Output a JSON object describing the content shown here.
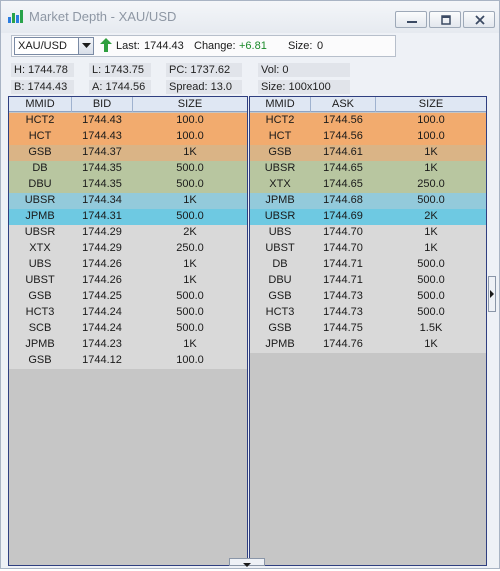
{
  "window": {
    "title": "Market Depth - XAU/USD"
  },
  "toolbar": {
    "symbol": "XAU/USD",
    "last_label": "Last:",
    "last_value": "1744.43",
    "change_label": "Change:",
    "change_value": "+6.81",
    "size_label": "Size:",
    "size_value": "0"
  },
  "stats": {
    "high": "H: 1744.78",
    "low": "L: 1743.75",
    "pc": "PC: 1737.62",
    "vol": "Vol: 0",
    "bid": "B: 1744.43",
    "ask": "A: 1744.56",
    "spread": "Spread: 13.0",
    "size": "Size: 100x100"
  },
  "bid_panel": {
    "columns": [
      "MMID",
      "BID",
      "SIZE"
    ],
    "rows": [
      {
        "mmid": "HCT2",
        "price": "1744.43",
        "size": "100.0",
        "color": "#f2ab6e"
      },
      {
        "mmid": "HCT",
        "price": "1744.43",
        "size": "100.0",
        "color": "#f2ab6e"
      },
      {
        "mmid": "GSB",
        "price": "1744.37",
        "size": "1K",
        "color": "#dab486"
      },
      {
        "mmid": "DB",
        "price": "1744.35",
        "size": "500.0",
        "color": "#b8c6a0"
      },
      {
        "mmid": "DBU",
        "price": "1744.35",
        "size": "500.0",
        "color": "#b8c6a0"
      },
      {
        "mmid": "UBSR",
        "price": "1744.34",
        "size": "1K",
        "color": "#93cadb"
      },
      {
        "mmid": "JPMB",
        "price": "1744.31",
        "size": "500.0",
        "color": "#6ec9e2"
      },
      {
        "mmid": "UBSR",
        "price": "1744.29",
        "size": "2K",
        "color": "#d9d9d9"
      },
      {
        "mmid": "XTX",
        "price": "1744.29",
        "size": "250.0",
        "color": "#d9d9d9"
      },
      {
        "mmid": "UBS",
        "price": "1744.26",
        "size": "1K",
        "color": "#d9d9d9"
      },
      {
        "mmid": "UBST",
        "price": "1744.26",
        "size": "1K",
        "color": "#d9d9d9"
      },
      {
        "mmid": "GSB",
        "price": "1744.25",
        "size": "500.0",
        "color": "#d9d9d9"
      },
      {
        "mmid": "HCT3",
        "price": "1744.24",
        "size": "500.0",
        "color": "#d9d9d9"
      },
      {
        "mmid": "SCB",
        "price": "1744.24",
        "size": "500.0",
        "color": "#d9d9d9"
      },
      {
        "mmid": "JPMB",
        "price": "1744.23",
        "size": "1K",
        "color": "#d9d9d9"
      },
      {
        "mmid": "GSB",
        "price": "1744.12",
        "size": "100.0",
        "color": "#d9d9d9"
      }
    ]
  },
  "ask_panel": {
    "columns": [
      "MMID",
      "ASK",
      "SIZE"
    ],
    "rows": [
      {
        "mmid": "HCT2",
        "price": "1744.56",
        "size": "100.0",
        "color": "#f2ab6e"
      },
      {
        "mmid": "HCT",
        "price": "1744.56",
        "size": "100.0",
        "color": "#f2ab6e"
      },
      {
        "mmid": "GSB",
        "price": "1744.61",
        "size": "1K",
        "color": "#dab486"
      },
      {
        "mmid": "UBSR",
        "price": "1744.65",
        "size": "1K",
        "color": "#b8c6a0"
      },
      {
        "mmid": "XTX",
        "price": "1744.65",
        "size": "250.0",
        "color": "#b8c6a0"
      },
      {
        "mmid": "JPMB",
        "price": "1744.68",
        "size": "500.0",
        "color": "#93cadb"
      },
      {
        "mmid": "UBSR",
        "price": "1744.69",
        "size": "2K",
        "color": "#6ec9e2"
      },
      {
        "mmid": "UBS",
        "price": "1744.70",
        "size": "1K",
        "color": "#d9d9d9"
      },
      {
        "mmid": "UBST",
        "price": "1744.70",
        "size": "1K",
        "color": "#d9d9d9"
      },
      {
        "mmid": "DB",
        "price": "1744.71",
        "size": "500.0",
        "color": "#d9d9d9"
      },
      {
        "mmid": "DBU",
        "price": "1744.71",
        "size": "500.0",
        "color": "#d9d9d9"
      },
      {
        "mmid": "GSB",
        "price": "1744.73",
        "size": "500.0",
        "color": "#d9d9d9"
      },
      {
        "mmid": "HCT3",
        "price": "1744.73",
        "size": "500.0",
        "color": "#d9d9d9"
      },
      {
        "mmid": "GSB",
        "price": "1744.75",
        "size": "1.5K",
        "color": "#d9d9d9"
      },
      {
        "mmid": "JPMB",
        "price": "1744.76",
        "size": "1K",
        "color": "#d9d9d9"
      }
    ]
  },
  "icons": {
    "app": "market-depth-chart-icon",
    "change": "green-up-arrow-icon"
  }
}
